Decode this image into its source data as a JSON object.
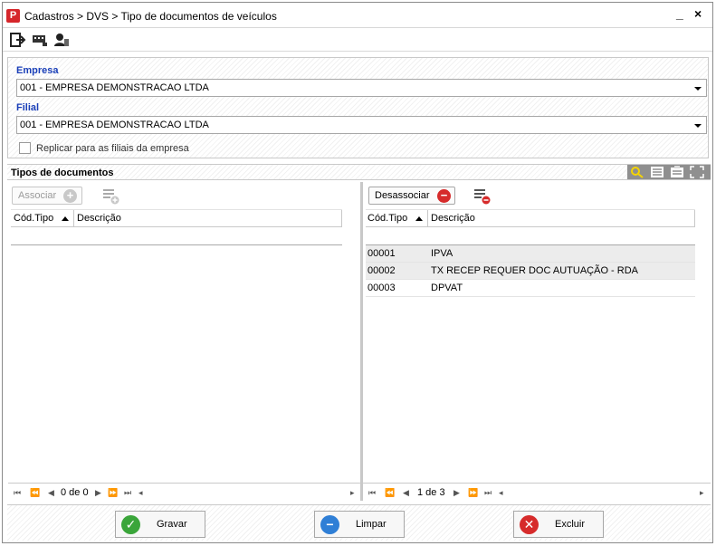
{
  "window": {
    "title": "Cadastros > DVS > Tipo de documentos de veículos",
    "minimize": "_",
    "close": "×"
  },
  "toolbar": {
    "icons": [
      "exit-icon",
      "keyboard-icon",
      "user-icon"
    ]
  },
  "filters": {
    "empresa_label": "Empresa",
    "empresa_value": "001 - EMPRESA DEMONSTRACAO LTDA",
    "filial_label": "Filial",
    "filial_value": "001 - EMPRESA DEMONSTRACAO LTDA",
    "replicar_label": "Replicar para as filiais da empresa",
    "replicar_checked": false
  },
  "section": {
    "title": "Tipos de documentos"
  },
  "left": {
    "associate_label": "Associar",
    "columns": [
      "Cód.Tipo",
      "Descrição"
    ],
    "rows": [],
    "pager": "0 de 0"
  },
  "right": {
    "disassociate_label": "Desassociar",
    "columns": [
      "Cód.Tipo",
      "Descrição"
    ],
    "rows": [
      {
        "code": "00001",
        "desc": "IPVA"
      },
      {
        "code": "00002",
        "desc": "TX RECEP REQUER DOC AUTUAÇÃO - RDA"
      },
      {
        "code": "00003",
        "desc": "DPVAT"
      }
    ],
    "pager": "1 de 3"
  },
  "footer": {
    "save_label": "Gravar",
    "clear_label": "Limpar",
    "delete_label": "Excluir"
  },
  "colors": {
    "label_blue": "#1a3fb8",
    "save_green": "#3aa53a",
    "clear_blue": "#2f7fd6",
    "delete_red": "#d62b2b"
  }
}
